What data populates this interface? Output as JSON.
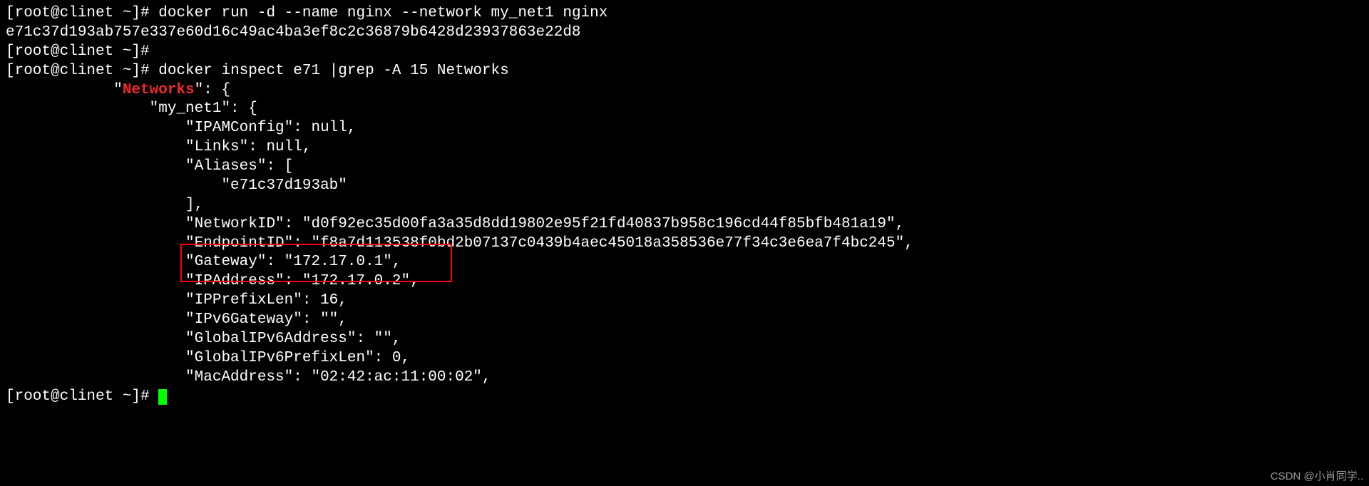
{
  "prompt1": "[root@clinet ~]# ",
  "cmd1": "docker run -d --name nginx --network my_net1 nginx",
  "out1": "e71c37d193ab757e337e60d16c49ac4ba3ef8c2c36879b6428d23937863e22d8",
  "prompt2": "[root@clinet ~]# ",
  "prompt3": "[root@clinet ~]# ",
  "cmd3": "docker inspect e71 |grep -A 15 Networks",
  "indent1": "            \"",
  "networks_key": "Networks",
  "networks_tail": "\": {",
  "l_mynet1": "                \"my_net1\": {",
  "l_ipamconfig": "                    \"IPAMConfig\": null,",
  "l_links": "                    \"Links\": null,",
  "l_aliases": "                    \"Aliases\": [",
  "l_alias_val": "                        \"e71c37d193ab\"",
  "l_aliases_end": "                    ],",
  "l_networkid": "                    \"NetworkID\": \"d0f92ec35d00fa3a35d8dd19802e95f21fd40837b958c196cd44f85bfb481a19\",",
  "l_endpointid": "                    \"EndpointID\": \"f8a7d113538f0bd2b07137c0439b4aec45018a358536e77f34c3e6ea7f4bc245\",",
  "l_gateway": "                    \"Gateway\": \"172.17.0.1\",",
  "l_ipaddress": "                    \"IPAddress\": \"172.17.0.2\",",
  "l_ipprefixlen": "                    \"IPPrefixLen\": 16,",
  "l_ipv6gateway": "                    \"IPv6Gateway\": \"\",",
  "l_globalipv6": "                    \"GlobalIPv6Address\": \"\",",
  "l_globalipv6p": "                    \"GlobalIPv6PrefixLen\": 0,",
  "l_macaddress": "                    \"MacAddress\": \"02:42:ac:11:00:02\",",
  "prompt4": "[root@clinet ~]# ",
  "watermark": "CSDN @小肖同学.."
}
